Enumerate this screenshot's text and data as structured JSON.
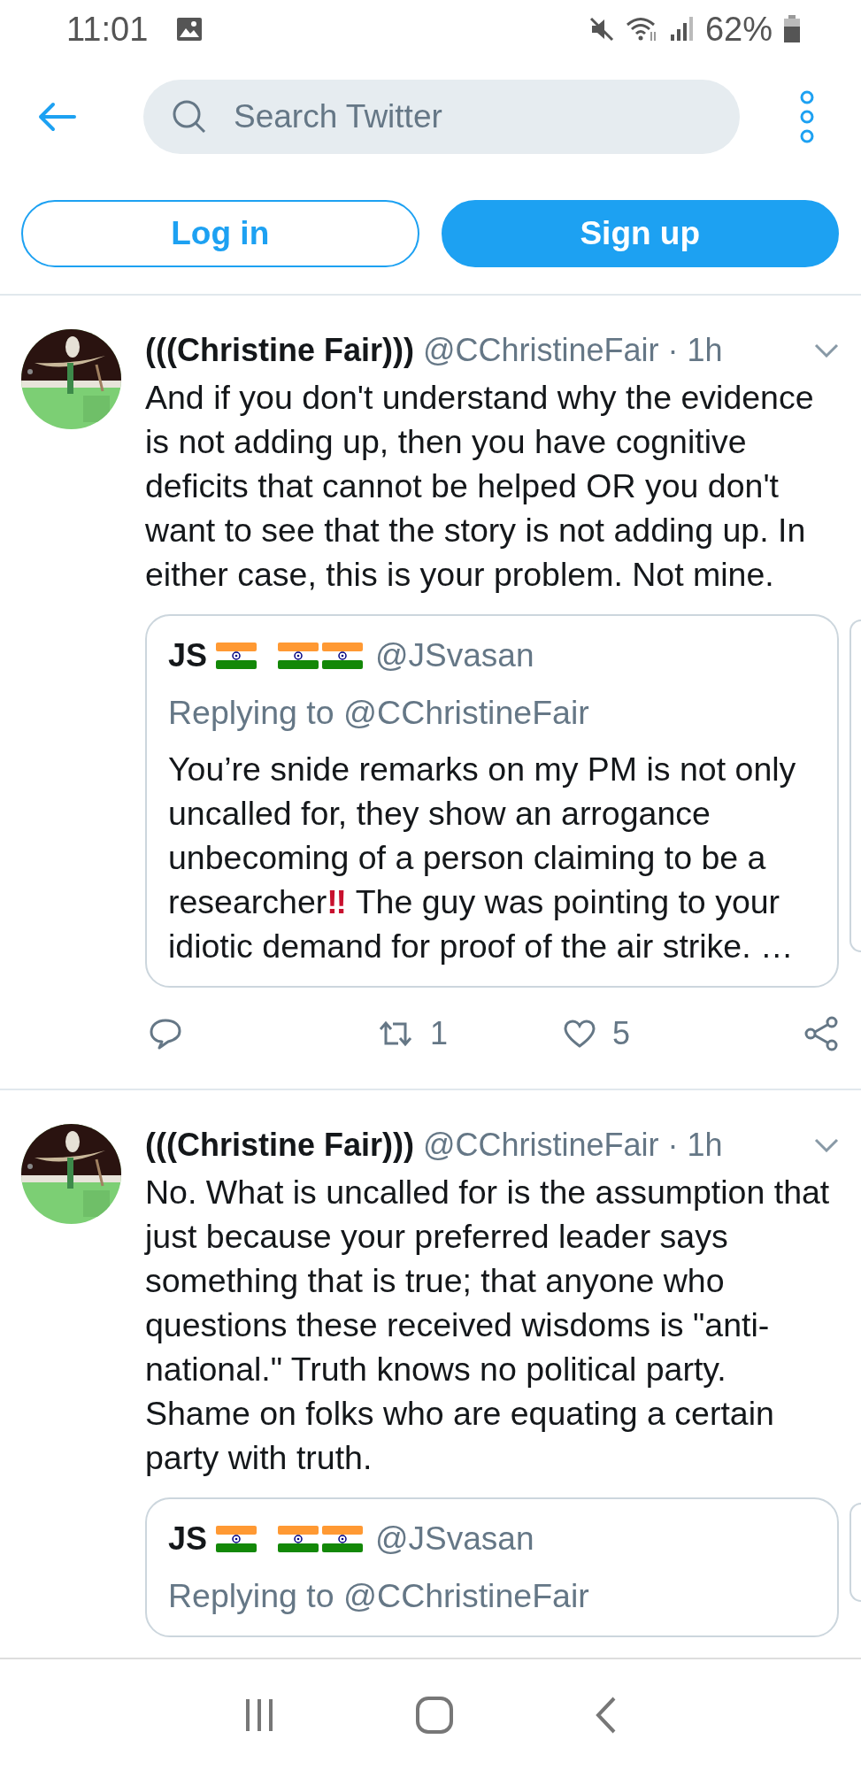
{
  "status_bar": {
    "time": "11:01",
    "battery": "62%"
  },
  "header": {
    "search": {
      "placeholder": "Search Twitter"
    }
  },
  "auth_buttons": [
    {
      "label": "Log in",
      "kind": "outline"
    },
    {
      "label": "Sign up",
      "kind": "filled"
    }
  ],
  "tweets": [
    {
      "name": "(((Christine Fair)))",
      "meta": "@CChristineFair · 1h",
      "text": "And if you don't understand why the evidence is not adding up, then you have cognitive deficits that cannot be helped OR you don't want to see that the story is not adding up. In either case, this is your problem. Not mine.",
      "quote": {
        "name": "JS",
        "flags": [
          {
            "kind": "flag"
          },
          {
            "kind": "flag"
          },
          {
            "kind": "flag"
          }
        ],
        "handle": "@JSvasan",
        "replying": "Replying to @CChristineFair",
        "text_parts": [
          {
            "kind": "plain",
            "text": "You’re snide remarks on my PM is not only uncalled for, they show an arrogance unbecoming of a person claiming to be a researcher"
          },
          {
            "kind": "emoji",
            "text": "‼"
          },
          {
            "kind": "plain",
            "text": " The guy was pointing to your idiotic demand for proof of the air strike. …"
          }
        ]
      },
      "actions": {
        "retweets": "1",
        "likes": "5"
      }
    },
    {
      "name": "(((Christine Fair)))",
      "meta": "@CChristineFair · 1h",
      "text": "No. What is uncalled for is the assumption that just because your preferred leader says something that is true; that anyone who questions these received wisdoms is \"anti-national.\" Truth knows no political party. Shame on folks who are equating a certain party with truth.",
      "quote": {
        "name": "JS",
        "flags": [
          {
            "kind": "flag"
          },
          {
            "kind": "flag"
          },
          {
            "kind": "flag"
          }
        ],
        "handle": "@JSvasan",
        "replying": "Replying to @CChristineFair"
      }
    }
  ]
}
